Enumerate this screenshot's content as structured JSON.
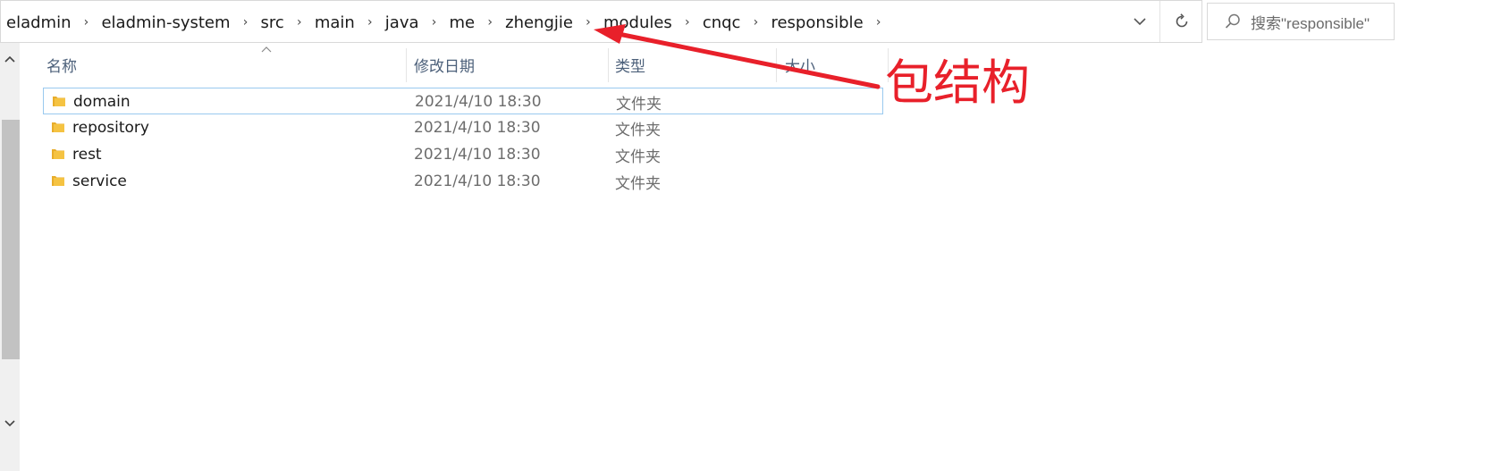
{
  "address_bar": {
    "breadcrumbs": [
      "eladmin",
      "eladmin-system",
      "src",
      "main",
      "java",
      "me",
      "zhengjie",
      "modules",
      "cnqc",
      "responsible"
    ],
    "separator": "›"
  },
  "search": {
    "placeholder": "搜索\"responsible\""
  },
  "columns": {
    "name": "名称",
    "date": "修改日期",
    "type": "类型",
    "size": "大小"
  },
  "files": [
    {
      "name": "domain",
      "date": "2021/4/10 18:30",
      "type": "文件夹",
      "selected": true
    },
    {
      "name": "repository",
      "date": "2021/4/10 18:30",
      "type": "文件夹",
      "selected": false
    },
    {
      "name": "rest",
      "date": "2021/4/10 18:30",
      "type": "文件夹",
      "selected": false
    },
    {
      "name": "service",
      "date": "2021/4/10 18:30",
      "type": "文件夹",
      "selected": false
    }
  ],
  "annotation": {
    "text": "包结构",
    "color": "#e8202a"
  },
  "colors": {
    "folder": "#f5c342",
    "selection_border": "#99c9ef",
    "header_text": "#4c607a"
  },
  "icons": [
    "chevron-right-icon",
    "chevron-down-icon",
    "refresh-icon",
    "search-icon",
    "folder-icon",
    "sort-up-icon"
  ]
}
